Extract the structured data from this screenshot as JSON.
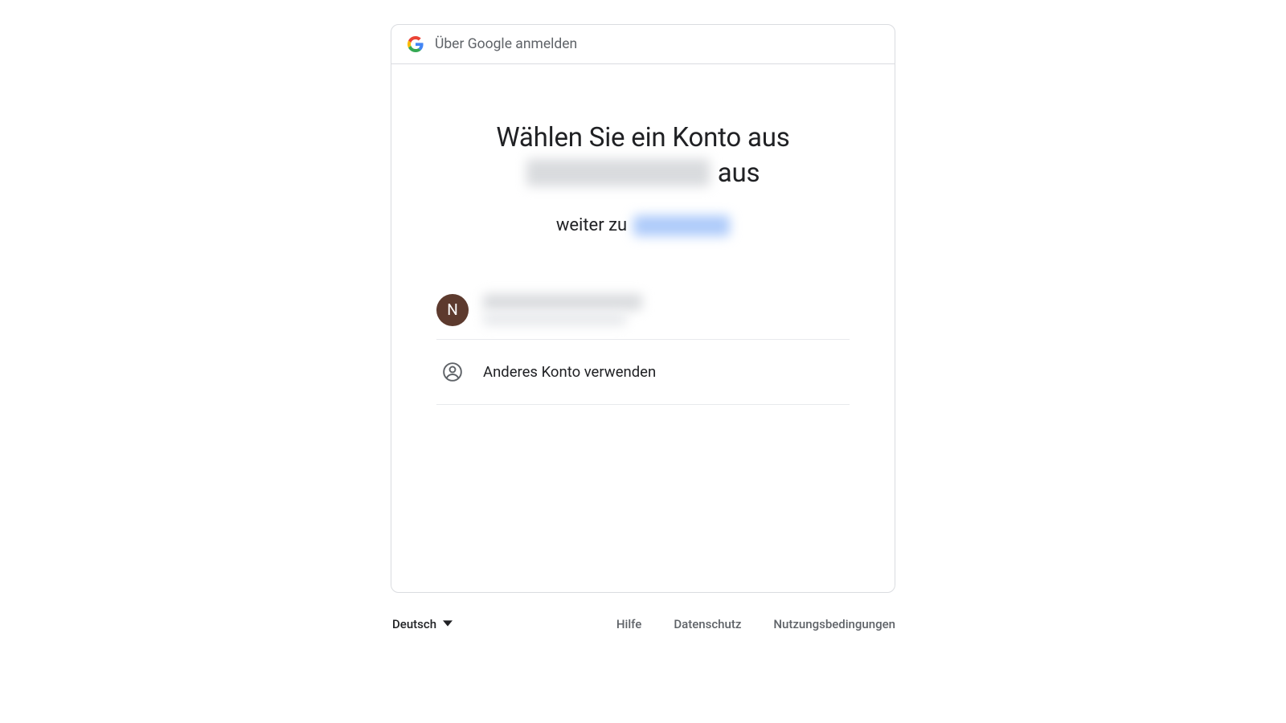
{
  "header": {
    "title": "Über Google anmelden"
  },
  "headline": {
    "line1": "Wählen Sie ein Konto aus",
    "line2_suffix": "aus"
  },
  "subline": {
    "prefix": "weiter zu"
  },
  "accounts": [
    {
      "avatar_initial": "N",
      "avatar_color": "#5d3a2e"
    }
  ],
  "other_account_label": "Anderes Konto verwenden",
  "footer": {
    "language": "Deutsch",
    "links": {
      "help": "Hilfe",
      "privacy": "Datenschutz",
      "terms": "Nutzungsbedingungen"
    }
  }
}
